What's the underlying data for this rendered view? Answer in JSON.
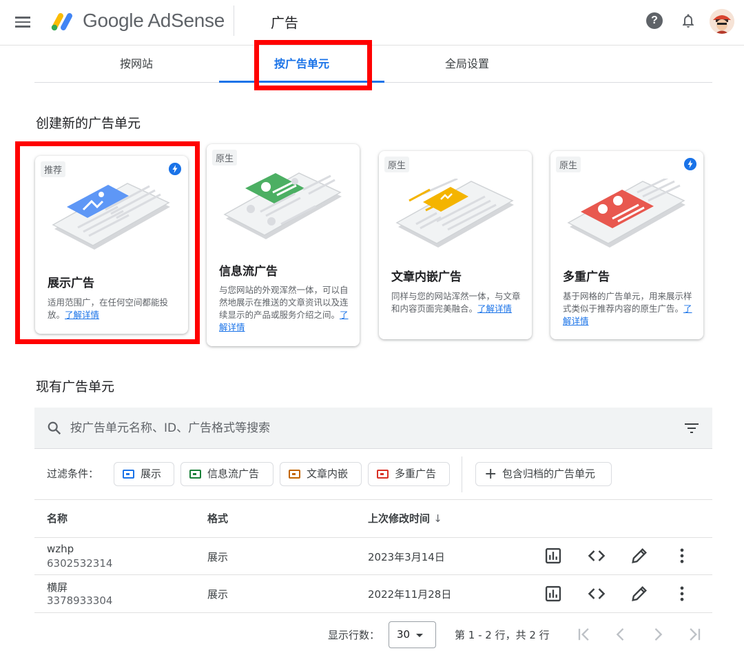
{
  "header": {
    "brand": "Google AdSense",
    "page_title": "广告",
    "help_symbol": "?"
  },
  "tabs": [
    {
      "label": "按网站",
      "active": false
    },
    {
      "label": "按广告单元",
      "active": true
    },
    {
      "label": "全局设置",
      "active": false
    }
  ],
  "create_section": {
    "title": "创建新的广告单元",
    "cards": [
      {
        "tag": "推荐",
        "title": "展示广告",
        "description": "适用范围广，在任何空间都能投放。",
        "learn_more": "了解详情",
        "accent": "#5e97f6",
        "has_bolt": true
      },
      {
        "tag": "原生",
        "title": "信息流广告",
        "description": "与您网站的外观浑然一体，可以自然地展示在推送的文章资讯以及连续显示的产品或服务介绍之间。",
        "learn_more": "了解详情",
        "accent": "#4caf63",
        "has_bolt": false
      },
      {
        "tag": "原生",
        "title": "文章内嵌广告",
        "description": "同样与您的网站浑然一体，与文章和内容页面完美融合。",
        "learn_more": "了解详情",
        "accent": "#f4b400",
        "has_bolt": false
      },
      {
        "tag": "原生",
        "title": "多重广告",
        "description": "基于网格的广告单元，用来展示样式类似于推荐内容的原生广告。",
        "learn_more": "了解详情",
        "accent": "#e8584f",
        "has_bolt": true
      }
    ]
  },
  "existing_section": {
    "title": "现有广告单元",
    "search_placeholder": "按广告单元名称、ID、广告格式等搜索",
    "filter_label": "过滤条件：",
    "chips": [
      {
        "label": "展示",
        "color": "#1a73e8"
      },
      {
        "label": "信息流广告",
        "color": "#188038"
      },
      {
        "label": "文章内嵌",
        "color": "#c26401"
      },
      {
        "label": "多重广告",
        "color": "#d93025"
      }
    ],
    "archive_chip": "包含归档的广告单元",
    "columns": [
      "名称",
      "格式",
      "上次修改时间"
    ],
    "sort_arrow": "↓",
    "rows": [
      {
        "name": "wzhp",
        "id": "6302532314",
        "format": "展示",
        "modified": "2023年3月14日"
      },
      {
        "name": "横屏",
        "id": "3378933304",
        "format": "展示",
        "modified": "2022年11月28日"
      }
    ]
  },
  "pagination": {
    "rows_label": "显示行数：",
    "rows_value": "30",
    "range_text": "第 1 - 2 行，共 2 行"
  }
}
